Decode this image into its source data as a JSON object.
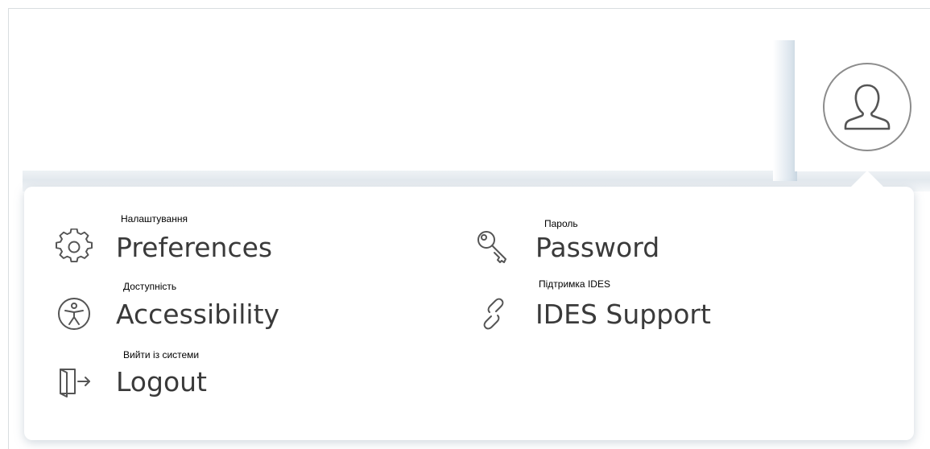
{
  "menu": {
    "items": [
      {
        "key": "preferences",
        "label": "Preferences",
        "caption": "Налаштування",
        "icon": "gear-icon"
      },
      {
        "key": "password",
        "label": "Password",
        "caption": "Пароль",
        "icon": "key-icon"
      },
      {
        "key": "accessibility",
        "label": "Accessibility",
        "caption": "Доступність",
        "icon": "accessibility-icon"
      },
      {
        "key": "ides-support",
        "label": "IDES Support",
        "caption": "Підтримка IDES",
        "icon": "link-icon"
      },
      {
        "key": "logout",
        "label": "Logout",
        "caption": "Вийти із системи",
        "icon": "logout-icon"
      }
    ]
  },
  "avatar": {
    "icon": "user-icon"
  },
  "colors": {
    "text": "#3a3a3a",
    "icon": "#555555",
    "avatar_border": "#8c8c8c",
    "card_background": "#ffffff"
  }
}
